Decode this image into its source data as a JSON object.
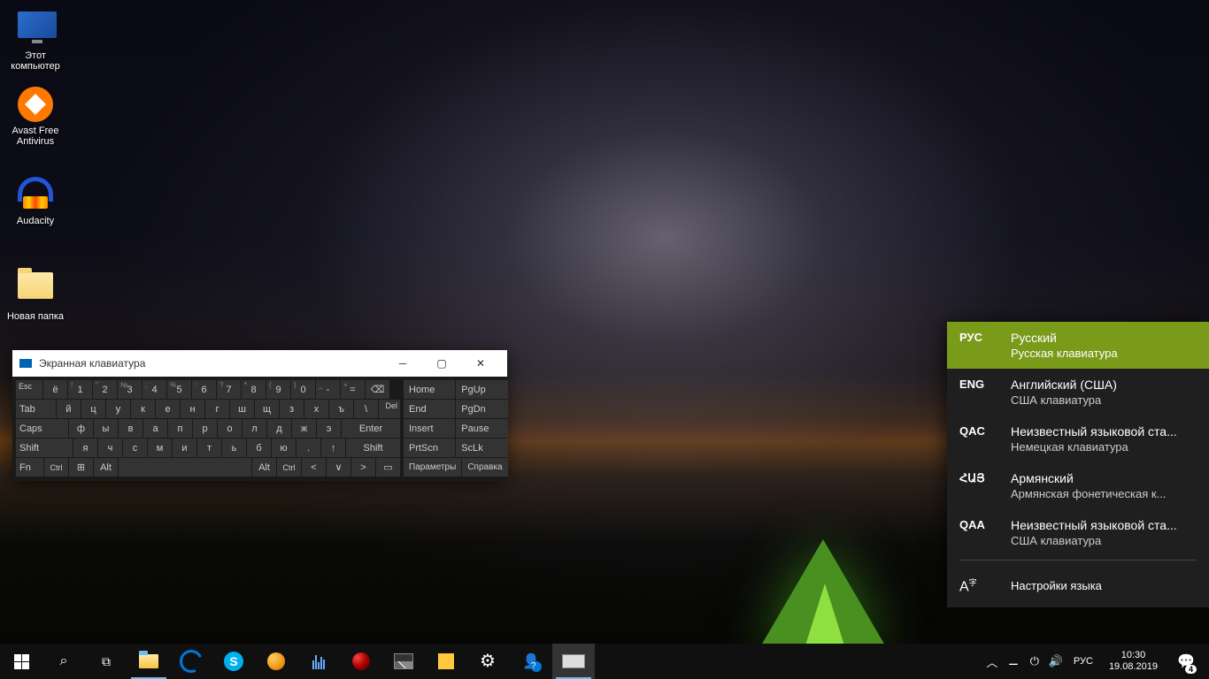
{
  "desktop": {
    "icons": [
      {
        "label": "Этот компьютер"
      },
      {
        "label": "Avast Free Antivirus"
      },
      {
        "label": "Audacity"
      },
      {
        "label": "Новая папка"
      }
    ]
  },
  "osk": {
    "title": "Экранная клавиатура",
    "rows": {
      "r1": [
        "Esc",
        "ё",
        "1",
        "2",
        "3",
        "4",
        "5",
        "6",
        "7",
        "8",
        "9",
        "0",
        "-",
        "="
      ],
      "r1_sup": [
        "",
        "",
        "!",
        "\"",
        "№",
        ";",
        "%",
        ":",
        "?",
        "*",
        "(",
        ")",
        "_",
        "+"
      ],
      "r2": [
        "Tab",
        "й",
        "ц",
        "у",
        "к",
        "е",
        "н",
        "г",
        "ш",
        "щ",
        "з",
        "х",
        "ъ",
        "\\"
      ],
      "r2_del": "Del",
      "r3": [
        "Caps",
        "ф",
        "ы",
        "в",
        "а",
        "п",
        "р",
        "о",
        "л",
        "д",
        "ж",
        "э",
        "Enter"
      ],
      "r4": [
        "Shift",
        "я",
        "ч",
        "с",
        "м",
        "и",
        "т",
        "ь",
        "б",
        "ю",
        ".",
        "↑",
        "Shift"
      ],
      "r5": [
        "Fn",
        "Ctrl",
        "⊞",
        "Alt",
        "",
        "Alt",
        "Ctrl",
        "<",
        "∨",
        ">",
        "▭"
      ]
    },
    "bksp": "⌫",
    "side": {
      "home": "Home",
      "pgup": "PgUp",
      "end": "End",
      "pgdn": "PgDn",
      "insert": "Insert",
      "pause": "Pause",
      "prtscn": "PrtScn",
      "sclk": "ScLk",
      "params": "Параметры",
      "help": "Справка"
    }
  },
  "lang": {
    "items": [
      {
        "code": "РУС",
        "name": "Русский",
        "kb": "Русская клавиатура",
        "selected": true
      },
      {
        "code": "ENG",
        "name": "Английский (США)",
        "kb": "США клавиатура"
      },
      {
        "code": "QAC",
        "name": "Неизвестный языковой ста...",
        "kb": "Немецкая клавиатура"
      },
      {
        "code": "ՀԱՅ",
        "name": "Армянский",
        "kb": "Армянская фонетическая к..."
      },
      {
        "code": "QAA",
        "name": "Неизвестный языковой ста...",
        "kb": "США клавиатура"
      }
    ],
    "settings": "Настройки языка"
  },
  "taskbar": {
    "lang": "РУС",
    "time": "10:30",
    "date": "19.08.2019",
    "notif_count": "4"
  }
}
